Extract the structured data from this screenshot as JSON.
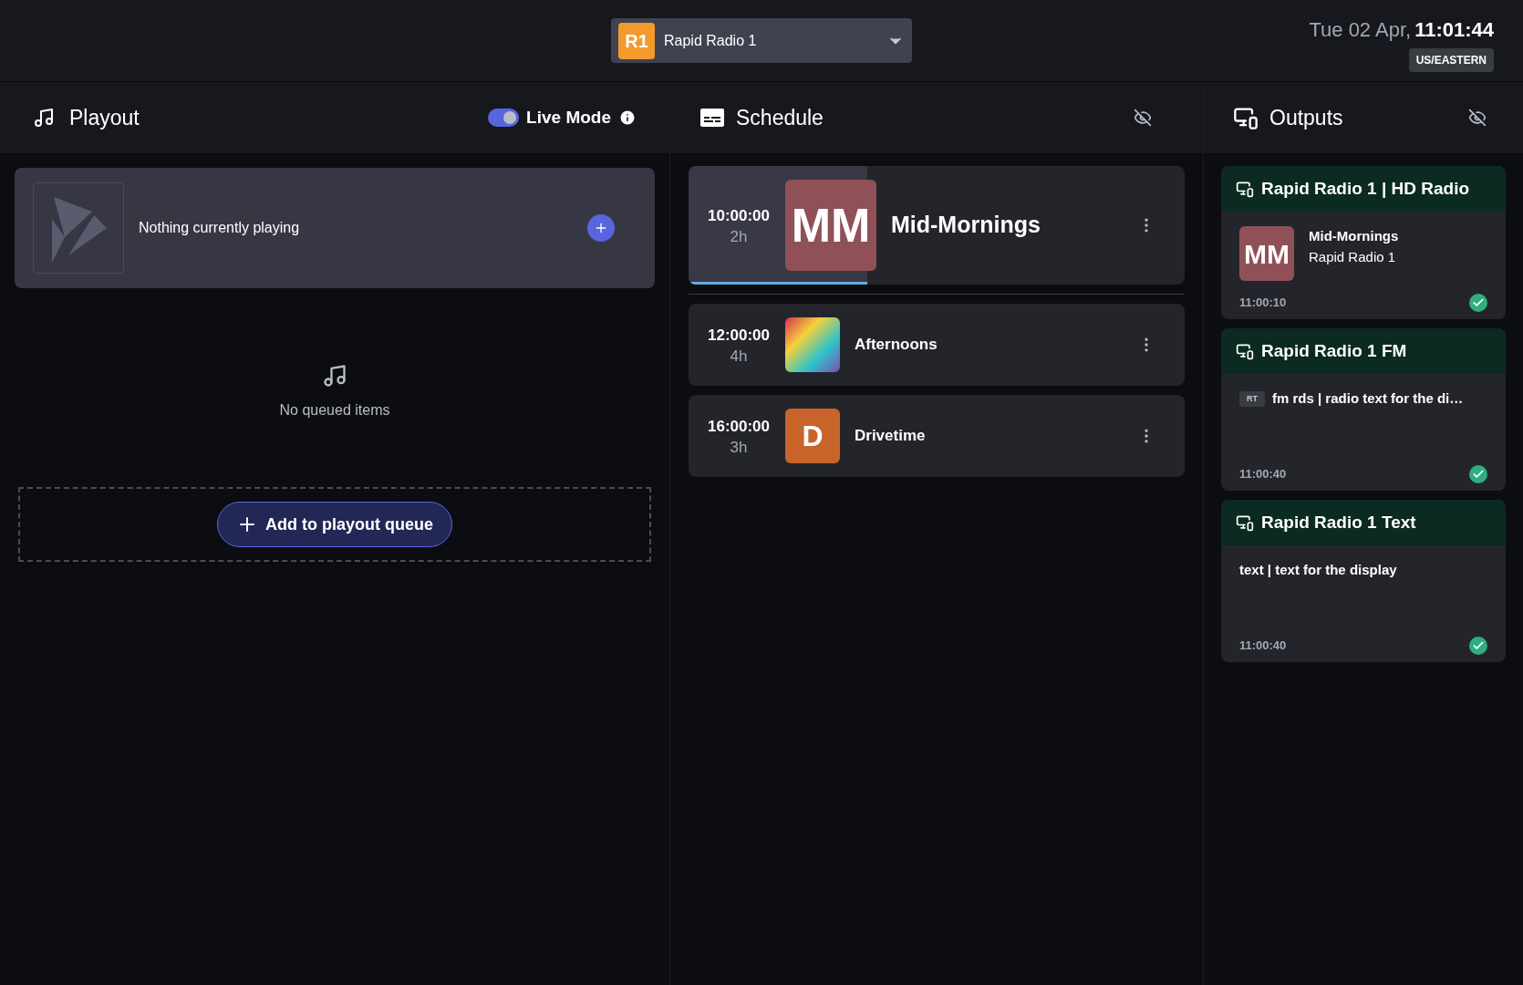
{
  "station_picker": {
    "badge": "R1",
    "name": "Rapid Radio 1"
  },
  "clock": {
    "date": "Tue 02 Apr,",
    "time": "11:01:44",
    "timezone": "US/EASTERN"
  },
  "playout": {
    "title": "Playout",
    "live_mode": {
      "label": "Live Mode",
      "on": true
    },
    "now_playing": "Nothing currently playing",
    "empty_queue": "No queued items",
    "add_button": "Add to playout queue"
  },
  "schedule": {
    "title": "Schedule",
    "items": [
      {
        "time": "10:00:00",
        "duration": "2h",
        "art": {
          "kind": "letters",
          "text": "MM",
          "color": "#8f5157"
        },
        "title": "Mid-Mornings",
        "current": true,
        "level": 0.36
      },
      {
        "time": "12:00:00",
        "duration": "4h",
        "art": {
          "kind": "photo"
        },
        "title": "Afternoons",
        "current": false
      },
      {
        "time": "16:00:00",
        "duration": "3h",
        "art": {
          "kind": "letters",
          "text": "D",
          "color": "#c8642a"
        },
        "title": "Drivetime",
        "current": false
      }
    ]
  },
  "outputs": {
    "title": "Outputs",
    "items": [
      {
        "title": "Rapid Radio 1 | HD Radio",
        "kind": "now_playing",
        "art": {
          "text": "MM",
          "color": "#8f5157"
        },
        "line_1": "Mid-Mornings",
        "line_2": "Rapid Radio 1",
        "time": "11:00:10",
        "ok": true
      },
      {
        "title": "Rapid Radio 1 FM",
        "kind": "rds",
        "badge": "RT",
        "text": "fm rds | radio text for the di…",
        "time": "11:00:40",
        "ok": true
      },
      {
        "title": "Rapid Radio 1 Text",
        "kind": "text",
        "text": "text | text for the display",
        "time": "11:00:40",
        "ok": true
      }
    ]
  }
}
